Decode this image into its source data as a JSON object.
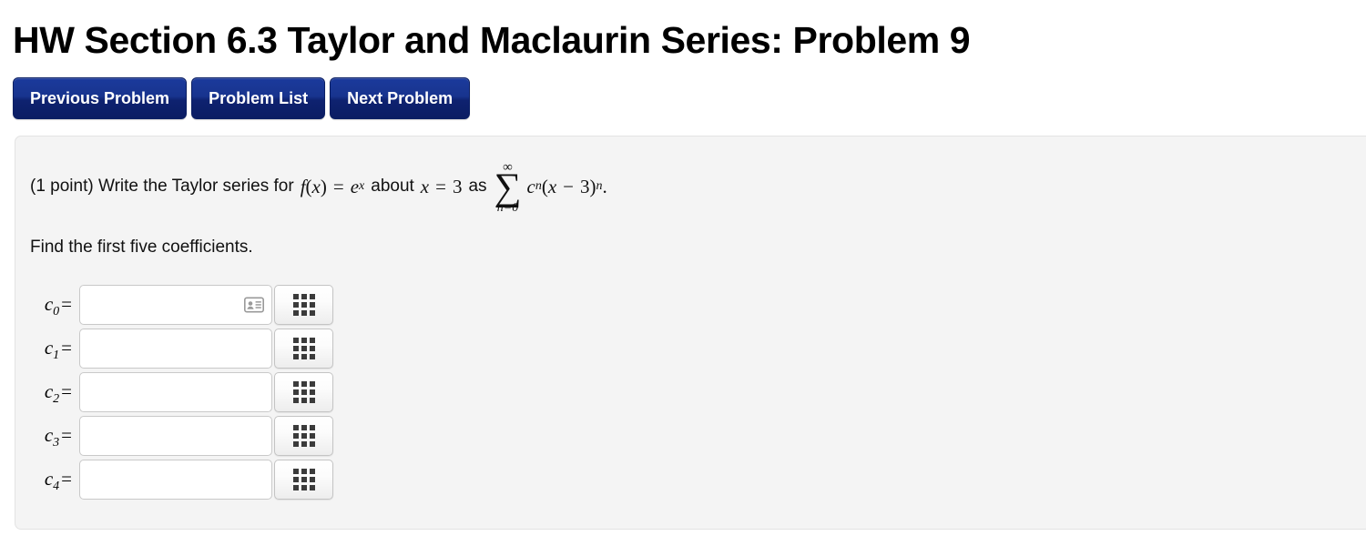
{
  "page": {
    "title": "HW Section 6.3 Taylor and Maclaurin Series: Problem 9"
  },
  "nav": {
    "buttons": [
      {
        "label": "Previous Problem",
        "name": "previous-problem-button"
      },
      {
        "label": "Problem List",
        "name": "problem-list-button"
      },
      {
        "label": "Next Problem",
        "name": "next-problem-button"
      }
    ]
  },
  "problem": {
    "points_text": "(1 point) Write the Taylor series for",
    "fx": "f",
    "fx_open": "(",
    "fx_var": "x",
    "fx_close": ")",
    "equals": "=",
    "function_base": "e",
    "function_exponent": "x",
    "about_text": "about",
    "center_var": "x",
    "center_equals": "=",
    "center_value": "3",
    "as_text": "as",
    "sum_upper": "∞",
    "sum_symbol": "∑",
    "sum_lower": "n=0",
    "coefficient_symbol": "c",
    "coefficient_index": "n",
    "term_open": "(",
    "term_var": "x",
    "term_minus": "−",
    "term_value": "3",
    "term_close": ")",
    "term_exponent": "n",
    "period": ".",
    "instruction": "Find the first five coefficients."
  },
  "answers": {
    "rows": [
      {
        "label": "c",
        "index": "0",
        "equals": "=",
        "value": "",
        "placeholder": "",
        "has_autofill_icon": true
      },
      {
        "label": "c",
        "index": "1",
        "equals": "=",
        "value": "",
        "placeholder": "",
        "has_autofill_icon": false
      },
      {
        "label": "c",
        "index": "2",
        "equals": "=",
        "value": "",
        "placeholder": "",
        "has_autofill_icon": false
      },
      {
        "label": "c",
        "index": "3",
        "equals": "=",
        "value": "",
        "placeholder": "",
        "has_autofill_icon": false
      },
      {
        "label": "c",
        "index": "4",
        "equals": "=",
        "value": "",
        "placeholder": "",
        "has_autofill_icon": false
      }
    ],
    "keypad_icon": "keypad-grid-icon",
    "autofill_icon": "contact-card-icon"
  },
  "colors": {
    "button_blue": "#18348e",
    "button_blue_dark": "#0b1d63",
    "panel_background": "#f4f4f4",
    "text": "#000000"
  }
}
